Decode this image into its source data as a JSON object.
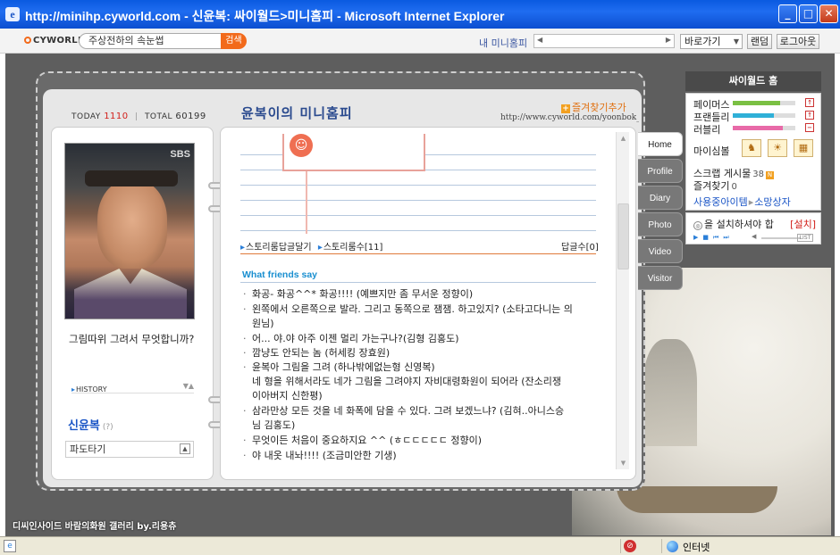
{
  "window": {
    "title": "http://minihp.cyworld.com - 신윤복: 싸이월드>미니홈피 - Microsoft Internet Explorer",
    "minimize": "_",
    "maximize": "□",
    "close": "✕"
  },
  "topbar": {
    "logo": "CYWORLD",
    "search_value": "주상전하의 속눈썹",
    "search_button": "검색",
    "my_minihome": "내 미니홈피",
    "goto": "바로가기",
    "random": "랜덤",
    "logout": "로그아웃"
  },
  "counter": {
    "today_label": "TODAY",
    "today_value": "1110",
    "separator": "|",
    "total_label": "TOTAL",
    "total_value": "60199"
  },
  "homepage": {
    "title": "윤복이의 미니홈피",
    "fav_add": "즐겨찾기추가",
    "url": "http://www.cyworld.com/yoonbok_e"
  },
  "profile": {
    "photo_watermark": "SBS",
    "message": "그림따위 그려서 무엇합니까?",
    "history": "HISTORY",
    "name": "신윤복",
    "gender": "(?)",
    "pado": "파도타기"
  },
  "story": {
    "reply_link": "스토리룸답글달기",
    "count_link": "스토리룸수[11]",
    "reply_count": "답글수[0]"
  },
  "friends": {
    "title": "What friends say",
    "items": [
      "화공- 화공^^* 화공!!!! (예쁘지만 좀 무서운 정향이)",
      "왼쪽에서 오른쪽으로 발라. 그리고 동쪽으로 잼잼. 하고있지? (소타고다니는 의원님)",
      "어... 야.야 아주 이젠 멀리 가는구나?(김형 김홍도)",
      "깜냥도 안되는 놈 (허세킹 장효원)",
      "윤복아 그림을 그려 (하나밖에없는형 신영복)\n네 형을 위해서라도 네가 그림을 그려야지 자비대령화원이 되어라 (잔소리쟁이아버지 신한평)",
      "삼라만상 모든 것을 네 화폭에 담을 수 있다. 그려 보겠느냐? (김혀..아니스승님 김홍도)",
      "무엇이든 처음이 중요하지요 ^^ (ㅎㄷㄷㄷㄷㄷ 정향이)",
      "야 내옷 내놔!!!! (조금미안한 기생)"
    ]
  },
  "tabs": [
    "Home",
    "Profile",
    "Diary",
    "Photo",
    "Video",
    "Visitor"
  ],
  "sidebar": {
    "header": "싸이월드 홈",
    "stats": [
      {
        "label": "페이머스",
        "level": 0.75,
        "color": "#7ac043",
        "indicator": "↑"
      },
      {
        "label": "프랜들리",
        "level": 0.65,
        "color": "#2fb0d8",
        "indicator": "↑"
      },
      {
        "label": "러블리",
        "level": 0.8,
        "color": "#e86aa8",
        "indicator": "−"
      }
    ],
    "mood_label": "마이심볼",
    "scrap_label": "스크랩 게시물",
    "scrap_count": "38",
    "scrap_new": "N",
    "fav_label": "즐겨찾기",
    "fav_count": "0",
    "items_link": "사용중아이템",
    "wish_link": "소망상자",
    "player_msg": "을 설치하셔야 합",
    "player_install": "[설치]",
    "player_list": "LIST"
  },
  "footer": {
    "credit": "디씨인사이드 바람의화원 갤러리 by.리용츄"
  },
  "statusbar": {
    "zone": "인터넷"
  }
}
